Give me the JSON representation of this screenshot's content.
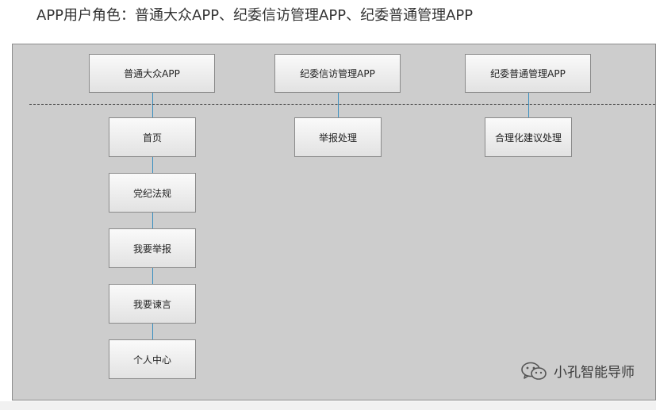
{
  "heading": "APP用户角色：普通大众APP、纪委信访管理APP、纪委普通管理APP",
  "roles": [
    {
      "label": "普通大众APP",
      "children": [
        "首页",
        "党纪法规",
        "我要举报",
        "我要谏言",
        "个人中心"
      ]
    },
    {
      "label": "纪委信访管理APP",
      "children": [
        "举报处理"
      ]
    },
    {
      "label": "纪委普通管理APP",
      "children": [
        "合理化建议处理"
      ]
    }
  ],
  "watermark": {
    "text": "小孔智能导师",
    "icon": "wechat-icon"
  },
  "colors": {
    "diagram_background": "#cdcdcd",
    "connector": "#3a8fc0",
    "box_fill": "#f0f0f0"
  }
}
